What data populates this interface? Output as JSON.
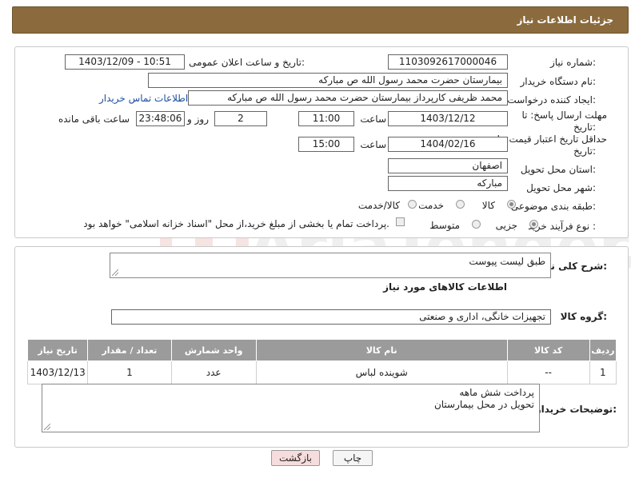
{
  "header": {
    "title": "جزئیات اطلاعات نیاز"
  },
  "form": {
    "need_number_label": "شماره نیاز:",
    "need_number": "1103092617000046",
    "announce_label": "تاریخ و ساعت اعلان عمومی:",
    "announce_value": "1403/12/09 - 10:51",
    "buyer_org_label": "نام دستگاه خریدار:",
    "buyer_org": "بیمارستان حضرت محمد رسول الله  ص  مبارکه",
    "creator_label": "ایجاد کننده درخواست:",
    "creator": "محمد ظریفی کارپرداز بیمارستان حضرت محمد رسول الله  ص  مبارکه",
    "contact_link": "اطلاعات تماس خریدار",
    "reply_deadline_label_1": "مهلت ارسال پاسخ: تا",
    "reply_deadline_label_2": "تاریخ:",
    "reply_date": "1403/12/12",
    "time_label": "ساعت",
    "reply_time": "11:00",
    "days_value": "2",
    "days_label": "روز و",
    "remaining_value": "23:48:06",
    "remaining_label": "ساعت باقی مانده",
    "price_valid_label_1": "حداقل تاریخ اعتبار قیمت: تا",
    "price_valid_label_2": "تاریخ:",
    "price_valid_date": "1404/02/16",
    "price_valid_time": "15:00",
    "province_label": "استان محل تحویل:",
    "province": "اصفهان",
    "city_label": "شهر محل تحویل:",
    "city": "مبارکه",
    "category_label": "طبقه بندی موضوعی:",
    "category_options": [
      "کالا",
      "خدمت",
      "کالا/خدمت"
    ],
    "process_label": "نوع فرآیند خرید :",
    "process_options": [
      "جزیی",
      "متوسط"
    ],
    "payment_note": "پرداخت تمام یا بخشی از مبلغ خرید،از محل \"اسناد خزانه اسلامی\" خواهد بود."
  },
  "details": {
    "summary_label": "شرح کلی نیاز:",
    "summary_value": "طبق لیست پیوست",
    "goods_info_title": "اطلاعات کالاهای مورد نیاز",
    "group_label": "گروه کالا:",
    "group_value": "تجهیزات خانگی، اداری و صنعتی",
    "table_headers": [
      "ردیف",
      "کد کالا",
      "نام کالا",
      "واحد شمارش",
      "تعداد / مقدار",
      "تاریخ نیاز"
    ],
    "rows": [
      [
        "1",
        "--",
        "شوینده لباس",
        "عدد",
        "1",
        "1403/12/13"
      ]
    ],
    "buyer_notes_label": "توضیحات خریدار:",
    "buyer_notes_line1": "پرداخت شش ماهه",
    "buyer_notes_line2": "تحویل در محل بیمارستان"
  },
  "buttons": {
    "print": "چاپ",
    "back": "بازگشت"
  },
  "watermark": {
    "text": "AriaTender.net"
  },
  "colors": {
    "header_bg": "#8b6b3d",
    "table_header_bg": "#9b9b9b",
    "link": "#1d4fa0",
    "back_button_bg": "#f6dcdc"
  }
}
